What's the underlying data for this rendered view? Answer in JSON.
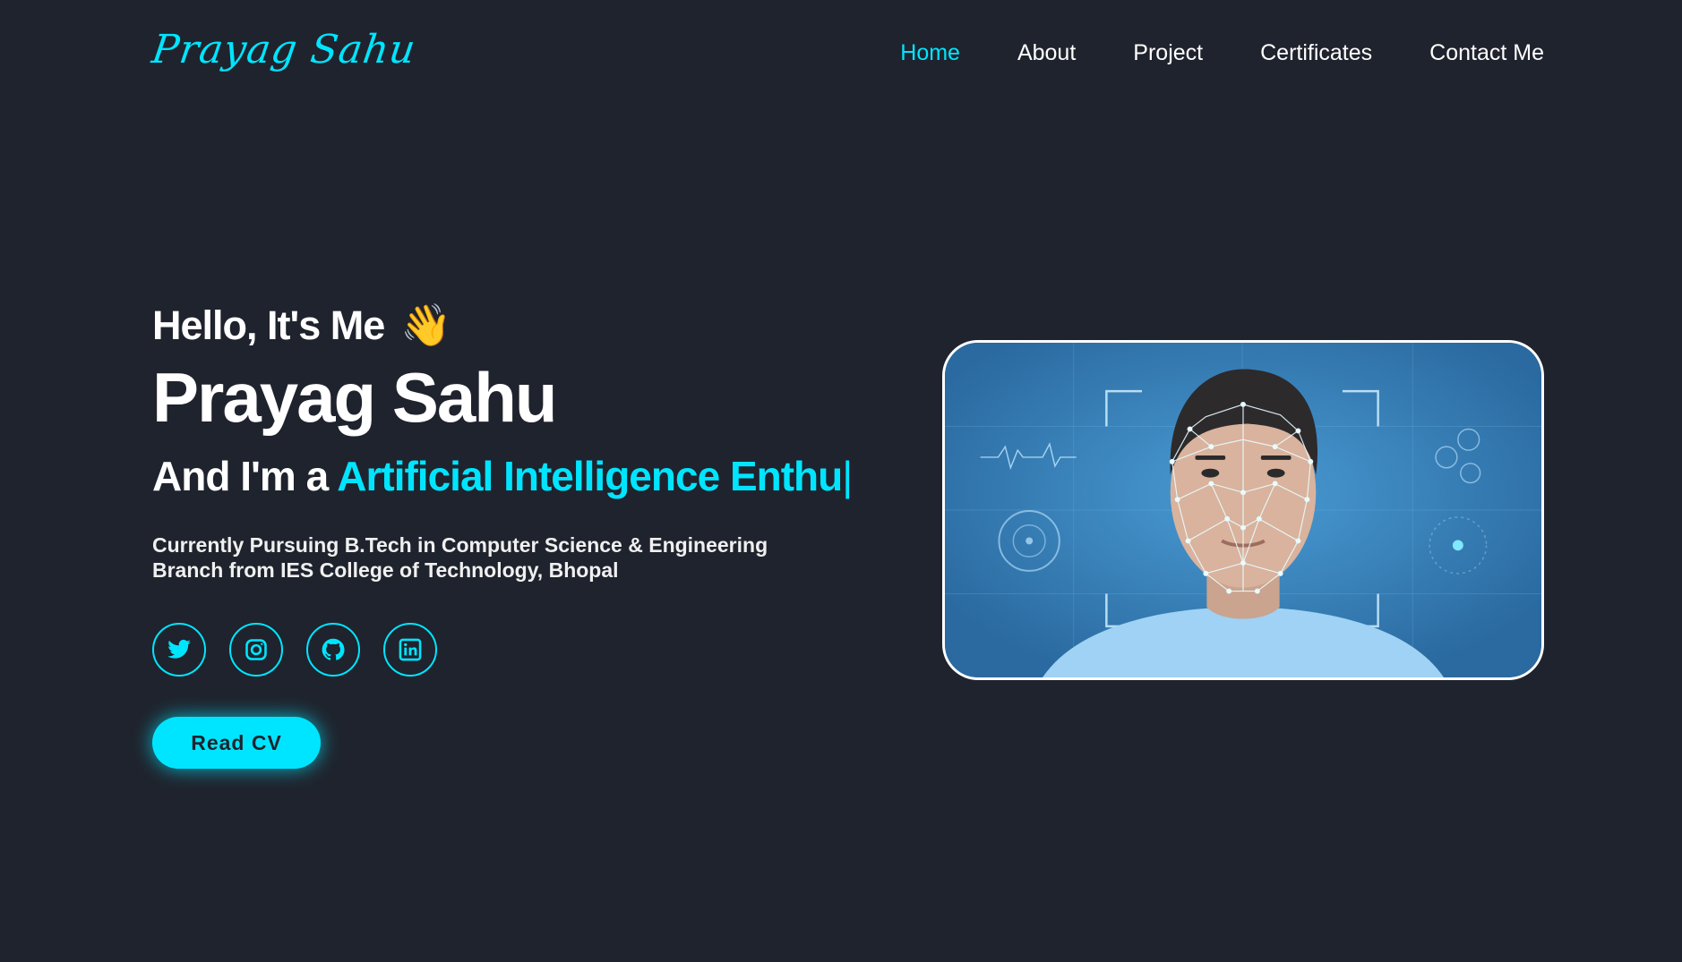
{
  "header": {
    "logo": "Prayag Sahu",
    "nav": [
      {
        "label": "Home",
        "active": true
      },
      {
        "label": "About",
        "active": false
      },
      {
        "label": "Project",
        "active": false
      },
      {
        "label": "Certificates",
        "active": false
      },
      {
        "label": "Contact Me",
        "active": false
      }
    ]
  },
  "hero": {
    "greeting": "Hello, It's Me",
    "wave_emoji": "👋",
    "name": "Prayag Sahu",
    "role_prefix": "And I'm a",
    "role_typed": "Artificial Intelligence Enthu",
    "caret": "|",
    "description_line1": "Currently Pursuing B.Tech in Computer Science & Engineering",
    "description_line2": "Branch from IES College of Technology, Bhopal",
    "socials": [
      {
        "icon": "twitter-icon"
      },
      {
        "icon": "instagram-icon"
      },
      {
        "icon": "github-icon"
      },
      {
        "icon": "linkedin-icon"
      }
    ],
    "cv_button": "Read CV"
  },
  "colors": {
    "accent": "#00e5ff",
    "background": "#1f232d",
    "text": "#ffffff"
  }
}
